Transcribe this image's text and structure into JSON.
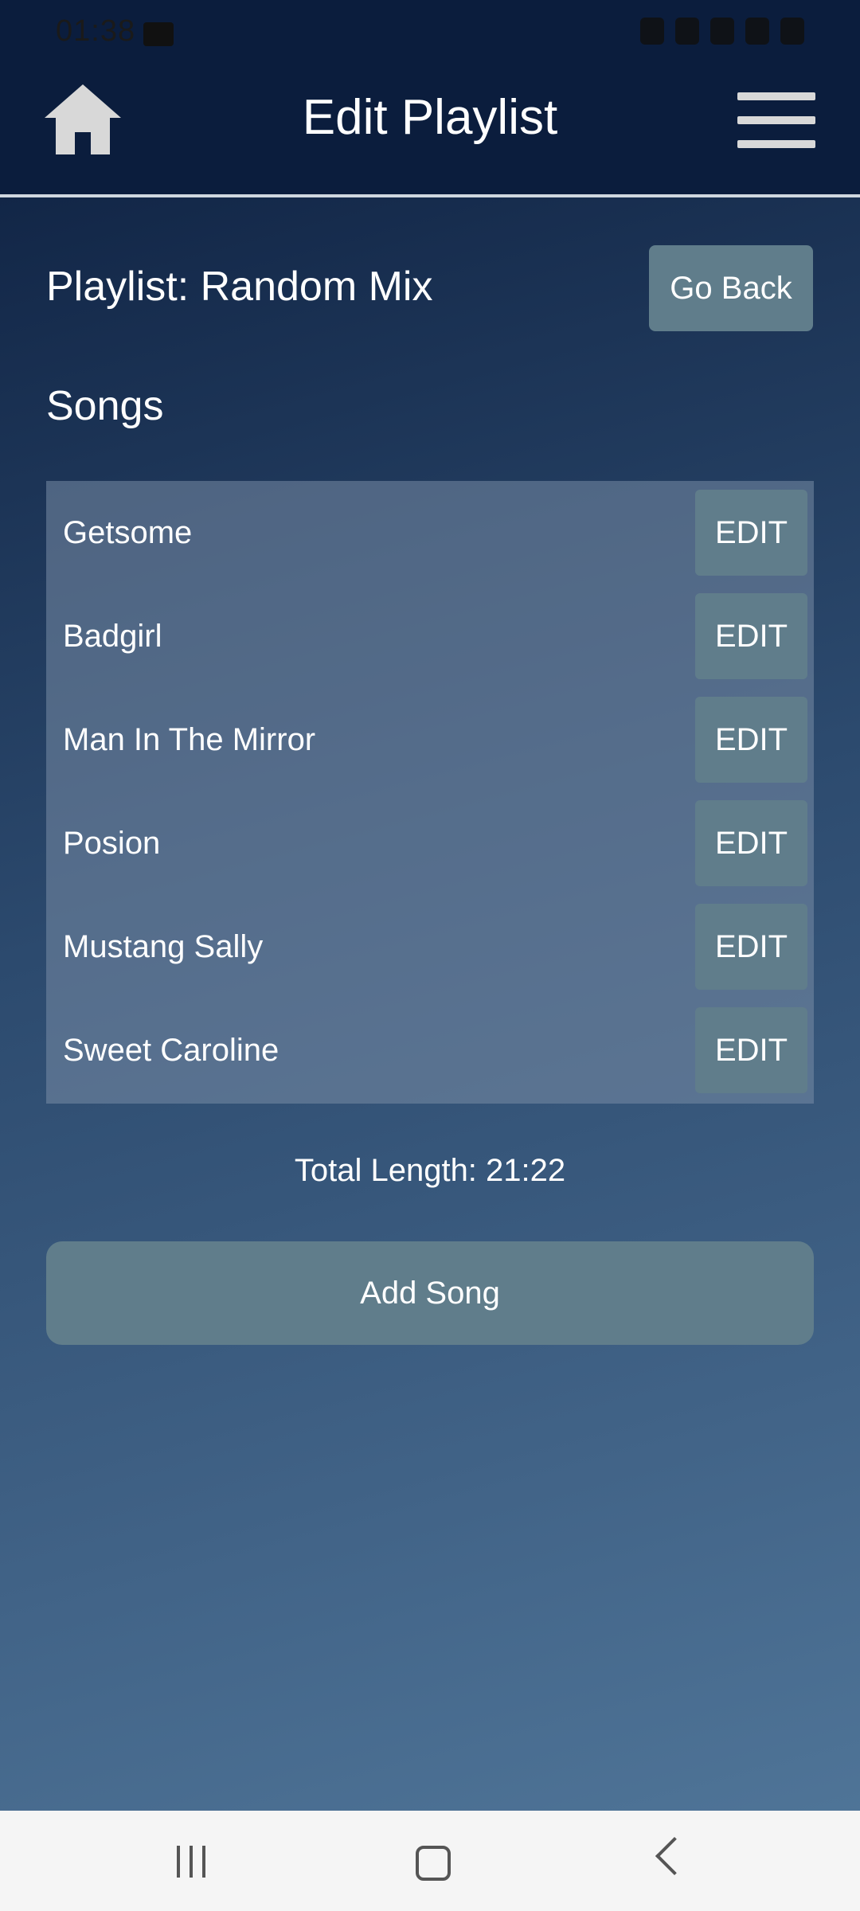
{
  "status_bar": {
    "time": "01:38"
  },
  "header": {
    "title": "Edit Playlist"
  },
  "playlist": {
    "name": "Playlist: Random Mix",
    "go_back_label": "Go Back",
    "songs_heading": "Songs"
  },
  "songs": [
    {
      "title": "Getsome",
      "edit_label": "EDIT"
    },
    {
      "title": "Badgirl",
      "edit_label": "EDIT"
    },
    {
      "title": "Man In The Mirror",
      "edit_label": "EDIT"
    },
    {
      "title": "Posion",
      "edit_label": "EDIT"
    },
    {
      "title": "Mustang Sally",
      "edit_label": "EDIT"
    },
    {
      "title": "Sweet Caroline",
      "edit_label": "EDIT"
    }
  ],
  "summary": {
    "total_length": "Total Length: 21:22"
  },
  "actions": {
    "add_song_label": "Add Song"
  },
  "icons": {
    "home": "home-icon",
    "menu": "hamburger-menu-icon",
    "nav_recents": "recent-apps-icon",
    "nav_home": "nav-home-icon",
    "nav_back": "back-arrow-icon"
  },
  "colors": {
    "header_bg": "#0b1d3d",
    "button_bg": "#607d8b",
    "text": "#ffffff"
  }
}
